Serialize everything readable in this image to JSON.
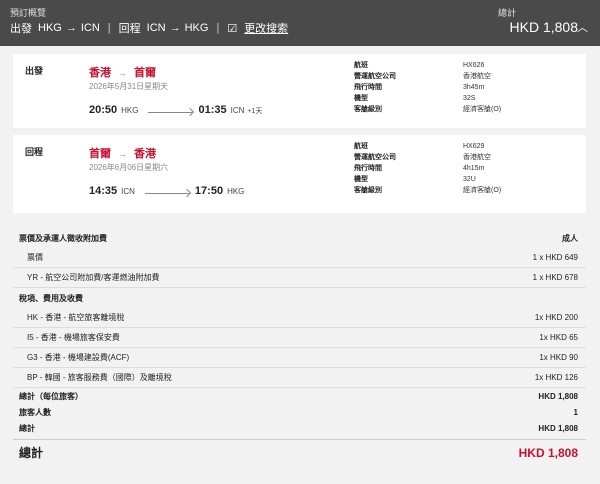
{
  "header": {
    "title": "預訂概覽",
    "outbound_label": "出發",
    "outbound_from": "HKG",
    "outbound_to": "ICN",
    "return_label": "回程",
    "return_from": "ICN",
    "return_to": "HKG",
    "edit_label": "更改搜索",
    "total_label": "總計",
    "total_value": "HKD 1,808"
  },
  "outbound": {
    "label": "出發",
    "from_city": "香港",
    "to_city": "首爾",
    "date": "2026年5月31日星期天",
    "dep_time": "20:50",
    "dep_code": "HKG",
    "arr_time": "01:35",
    "arr_code": "ICN",
    "next_day": "+1天",
    "details": [
      {
        "key": "航班",
        "value": "HX626"
      },
      {
        "key": "營運航空公司",
        "value": "香港航空"
      },
      {
        "key": "飛行時間",
        "value": "3h45m"
      },
      {
        "key": "機型",
        "value": "32S"
      },
      {
        "key": "客艙級別",
        "value": "經濟客艙(O)"
      }
    ]
  },
  "return": {
    "label": "回程",
    "from_city": "首爾",
    "to_city": "香港",
    "date": "2026年6月06日星期六",
    "dep_time": "14:35",
    "dep_code": "ICN",
    "arr_time": "17:50",
    "arr_code": "HKG",
    "details": [
      {
        "key": "航班",
        "value": "HX629"
      },
      {
        "key": "營運航空公司",
        "value": "香港航空"
      },
      {
        "key": "飛行時間",
        "value": "4h15m"
      },
      {
        "key": "機型",
        "value": "32U"
      },
      {
        "key": "客艙級別",
        "value": "經濟客艙(O)"
      }
    ]
  },
  "fare": {
    "section1_title": "票價及承運人徵收附加費",
    "section1_col": "成人",
    "section1_items": [
      {
        "label": "票價",
        "value": "1 x HKD 649"
      },
      {
        "label": "YR - 航空公司附加費/客運燃油附加費",
        "value": "1 x HKD 678"
      }
    ],
    "section2_title": "稅項、費用及收費",
    "section2_items": [
      {
        "label": "HK - 香港 - 航空旅客離境稅",
        "value": "1x HKD 200"
      },
      {
        "label": "I5 - 香港 - 機場旅客保安費",
        "value": "1x HKD 65"
      },
      {
        "label": "G3 - 香港 - 機場建設費(ACF)",
        "value": "1x HKD 90"
      },
      {
        "label": "BP - 韓國 - 旅客服務費（國際）及離境稅",
        "value": "1x HKD 126"
      }
    ],
    "per_pax_label": "總計（每位旅客）",
    "per_pax_value": "HKD 1,808",
    "pax_count_label": "旅客人數",
    "pax_count_value": "1",
    "subtotal_label": "總計",
    "subtotal_value": "HKD 1,808",
    "grand_label": "總計",
    "grand_value": "HKD 1,808"
  }
}
